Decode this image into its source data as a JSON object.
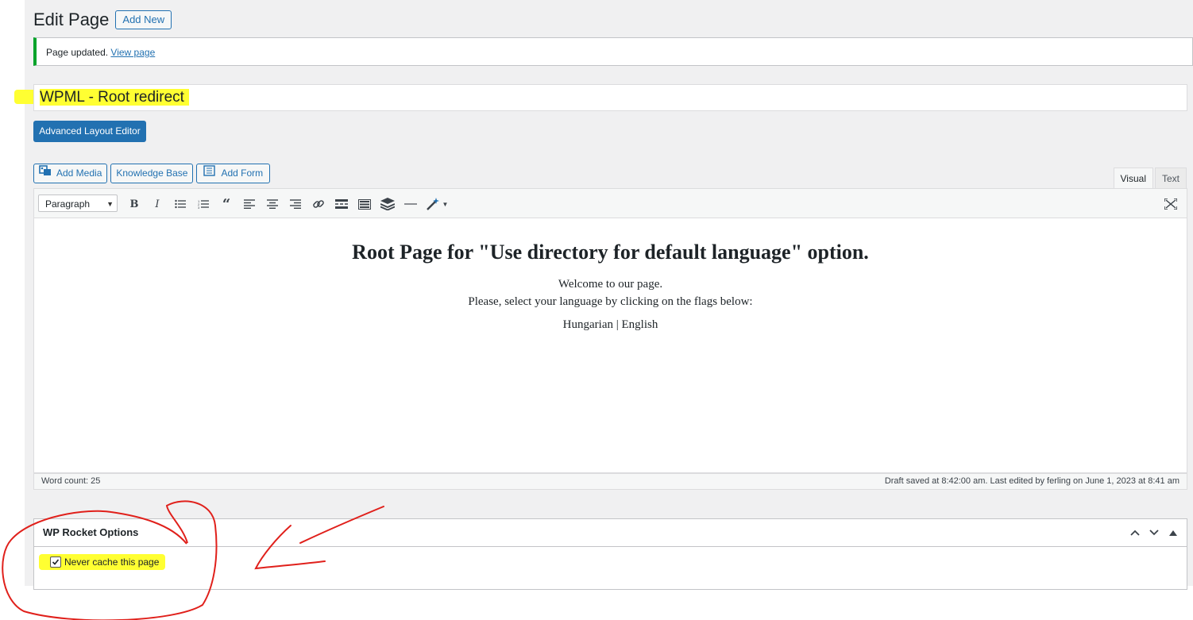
{
  "header": {
    "title": "Edit Page",
    "add_new": "Add New"
  },
  "notice": {
    "text": "Page updated.",
    "link": "View page"
  },
  "title_field": {
    "value": "WPML - Root redirect"
  },
  "advanced_editor_button": "Advanced Layout Editor",
  "media_buttons": [
    "Add Media",
    "Knowledge Base",
    "Add Form"
  ],
  "editor_tabs": {
    "visual": "Visual",
    "text": "Text"
  },
  "toolbar": {
    "format_select": "Paragraph",
    "icons": [
      "bold-icon",
      "italic-icon",
      "bulleted-list-icon",
      "numbered-list-icon",
      "blockquote-icon",
      "align-left-icon",
      "align-center-icon",
      "align-right-icon",
      "link-icon",
      "read-more-icon",
      "toolbar-toggle-icon",
      "layers-icon",
      "horizontal-rule-icon",
      "magic-wand-icon"
    ]
  },
  "content": {
    "heading": "Root Page for \"Use directory for default language\" option.",
    "line1": "Welcome to our page.",
    "line2": "Please, select your language by clicking on the flags below:",
    "languages": "Hungarian | English"
  },
  "status": {
    "word_count": "Word count: 25",
    "draft_info": "Draft saved at 8:42:00 am. Last edited by ferling on June 1, 2023 at 8:41 am"
  },
  "metabox": {
    "title": "WP Rocket Options",
    "checkbox_label": "Never cache this page",
    "checked": true
  },
  "colors": {
    "accent": "#2271b1",
    "notice_success": "#00a32a",
    "highlight": "#ffff32",
    "annotation": "#e0201b"
  }
}
